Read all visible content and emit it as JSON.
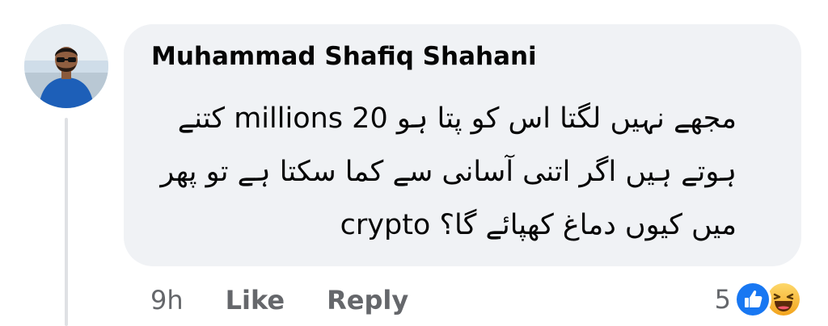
{
  "comment": {
    "author": "Muhammad Shafiq Shahani",
    "lines": [
      "مجھے نہیں لگتا اس کو پتا ہو 20 millions کتنے",
      "ہوتے ہیں اگر اتنی آسانی سے کما سکتا ہے تو پھر",
      "crypto میں کیوں دماغ کھپائے گا؟"
    ],
    "time": "9h",
    "like_label": "Like",
    "reply_label": "Reply",
    "reaction_count": "5",
    "reactions": [
      "like-icon",
      "haha-icon"
    ]
  },
  "colors": {
    "bubble_bg": "#f0f2f5",
    "text": "#050505",
    "meta": "#65676b",
    "like_blue": "#1877f2",
    "haha_yellow": "#f7b125"
  }
}
